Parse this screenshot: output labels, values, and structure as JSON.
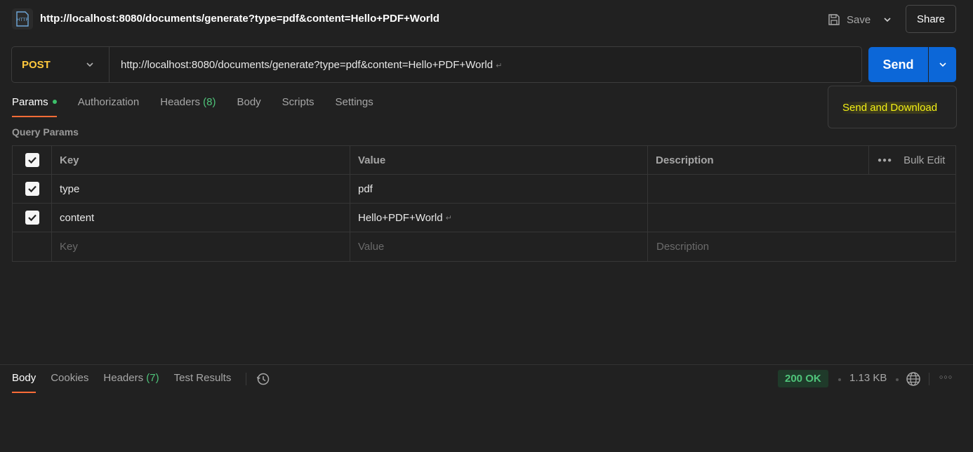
{
  "header": {
    "icon_label": "HTTP",
    "title": "http://localhost:8080/documents/generate?type=pdf&content=Hello+PDF+World",
    "save_label": "Save",
    "share_label": "Share"
  },
  "request": {
    "method": "POST",
    "url": "http://localhost:8080/documents/generate?type=pdf&content=Hello+PDF+World",
    "send_label": "Send"
  },
  "send_menu": {
    "items": [
      "Send and Download"
    ]
  },
  "tabs": [
    {
      "label": "Params",
      "active": true
    },
    {
      "label": "Authorization"
    },
    {
      "label": "Headers",
      "count": "(8)"
    },
    {
      "label": "Body"
    },
    {
      "label": "Scripts"
    },
    {
      "label": "Settings"
    }
  ],
  "query_params": {
    "section_label": "Query Params",
    "headers": {
      "key": "Key",
      "value": "Value",
      "description": "Description",
      "bulk_edit": "Bulk Edit"
    },
    "rows": [
      {
        "key": "type",
        "value": "pdf",
        "checked": true
      },
      {
        "key": "content",
        "value": "Hello+PDF+World",
        "checked": true
      }
    ],
    "placeholders": {
      "key": "Key",
      "value": "Value",
      "description": "Description"
    }
  },
  "response": {
    "tabs": [
      {
        "label": "Body",
        "active": true
      },
      {
        "label": "Cookies"
      },
      {
        "label": "Headers",
        "count": "(7)"
      },
      {
        "label": "Test Results"
      }
    ],
    "status": "200 OK",
    "size": "1.13 KB"
  },
  "colors": {
    "accent": "#ff6c37",
    "send": "#0c67d8",
    "method": "#ffc83d",
    "success": "#4fc47a",
    "highlight": "#f3f014"
  }
}
